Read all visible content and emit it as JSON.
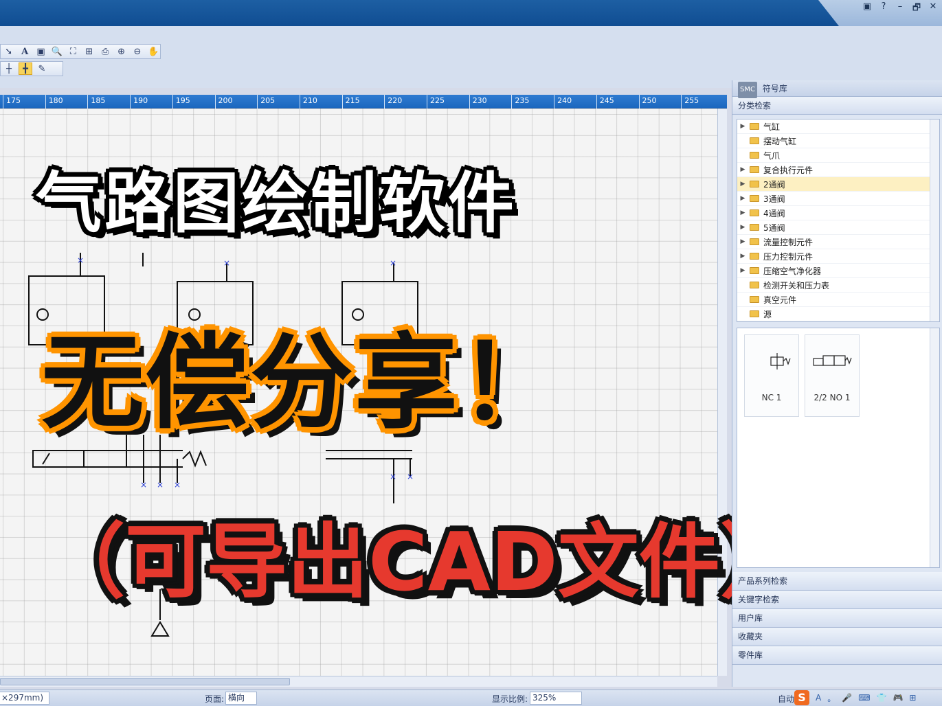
{
  "window": {
    "controls": [
      "▣",
      "?",
      "–",
      "🗗",
      "✕"
    ]
  },
  "toolbar": {
    "row1_icons": [
      "pointer-arrow-icon",
      "text-icon",
      "image-icon",
      "zoom-icon",
      "zoom-fit-icon",
      "zoom-grid-icon",
      "print-preview-icon",
      "zoom-in-icon",
      "zoom-out-icon",
      "pan-hand-icon"
    ],
    "row2_icons": [
      "crosshair-icon",
      "snap-icon",
      "pencil-icon"
    ]
  },
  "ruler": {
    "ticks": [
      "175",
      "180",
      "185",
      "190",
      "195",
      "200",
      "205",
      "210",
      "215",
      "220",
      "225",
      "230",
      "235",
      "240",
      "245",
      "250",
      "255"
    ]
  },
  "overlay": {
    "line1": "气路图绘制软件",
    "line2": "无偿分享！",
    "line3": "（可导出CAD文件）"
  },
  "panel": {
    "logo": "SMC",
    "title": "符号库",
    "category_search": "分类检索",
    "tree_items": [
      {
        "label": "气缸",
        "expandable": true
      },
      {
        "label": "摆动气缸",
        "expandable": false
      },
      {
        "label": "气爪",
        "expandable": false
      },
      {
        "label": "复合执行元件",
        "expandable": true
      },
      {
        "label": "2通阀",
        "expandable": true,
        "selected": true
      },
      {
        "label": "3通阀",
        "expandable": true
      },
      {
        "label": "4通阀",
        "expandable": true
      },
      {
        "label": "5通阀",
        "expandable": true
      },
      {
        "label": "流量控制元件",
        "expandable": true
      },
      {
        "label": "压力控制元件",
        "expandable": true
      },
      {
        "label": "压缩空气净化器",
        "expandable": true
      },
      {
        "label": "检测开关和压力表",
        "expandable": false
      },
      {
        "label": "真空元件",
        "expandable": false
      },
      {
        "label": "源",
        "expandable": false
      }
    ],
    "thumbnails": [
      {
        "label": "NC 1"
      },
      {
        "label": "2/2 NO 1"
      }
    ],
    "sections": [
      "产品系列检索",
      "关键字检索",
      "用户库",
      "收藏夹",
      "零件库"
    ]
  },
  "statusbar": {
    "paper": "×297mm)",
    "page_label": "页面:",
    "page_value": "横向",
    "scale_label": "显示比例:",
    "scale_value": "325%",
    "auto_label": "自动"
  },
  "tray": {
    "ime": "S",
    "items": [
      "A",
      "。",
      "🎤",
      "⌨",
      "👕",
      "🎮",
      "⊞"
    ]
  }
}
